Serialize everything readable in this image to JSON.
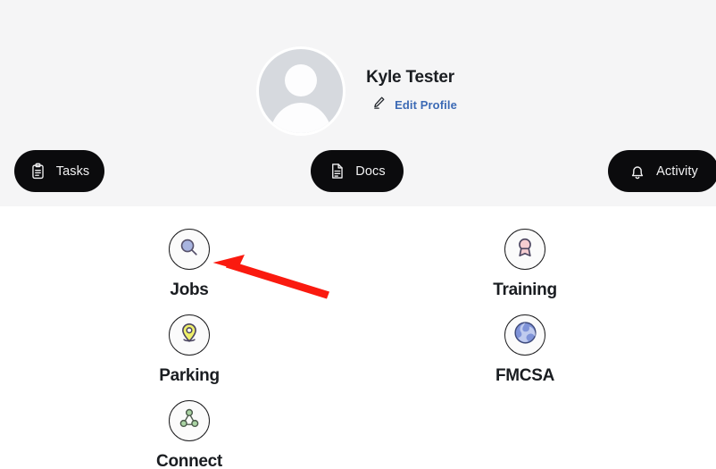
{
  "app": {
    "background_color": "#ffffff",
    "header_background_color": "#f5f5f6"
  },
  "profile": {
    "avatar_icon": "default-user-avatar-icon",
    "user_name": "Kyle Tester",
    "edit_profile_label": "Edit Profile",
    "edit_profile_icon": "pencil-icon",
    "edit_profile_color": "#3c6ab5"
  },
  "quick_actions": [
    {
      "id": "tasks",
      "label": "Tasks",
      "icon": "clipboard-icon"
    },
    {
      "id": "docs",
      "label": "Docs",
      "icon": "document-icon"
    },
    {
      "id": "activity",
      "label": "Activity",
      "icon": "bell-icon"
    }
  ],
  "menu_tiles": [
    {
      "id": "jobs",
      "label": "Jobs",
      "icon": "magnifying-glass-icon",
      "accent": "#a8b4e0"
    },
    {
      "id": "training",
      "label": "Training",
      "icon": "award-ribbon-icon",
      "accent": "#f5cdd1"
    },
    {
      "id": "parking",
      "label": "Parking",
      "icon": "map-pin-icon",
      "accent": "#eff06a"
    },
    {
      "id": "fmcsa",
      "label": "FMCSA",
      "icon": "swirl-logo-icon",
      "accent": "#9fb2e8"
    },
    {
      "id": "connect",
      "label": "Connect",
      "icon": "network-nodes-icon",
      "accent": "#a9d3a3"
    }
  ],
  "annotation": {
    "type": "arrow",
    "color": "#fa1a0f",
    "points_to": "jobs",
    "direction": "up-left"
  }
}
